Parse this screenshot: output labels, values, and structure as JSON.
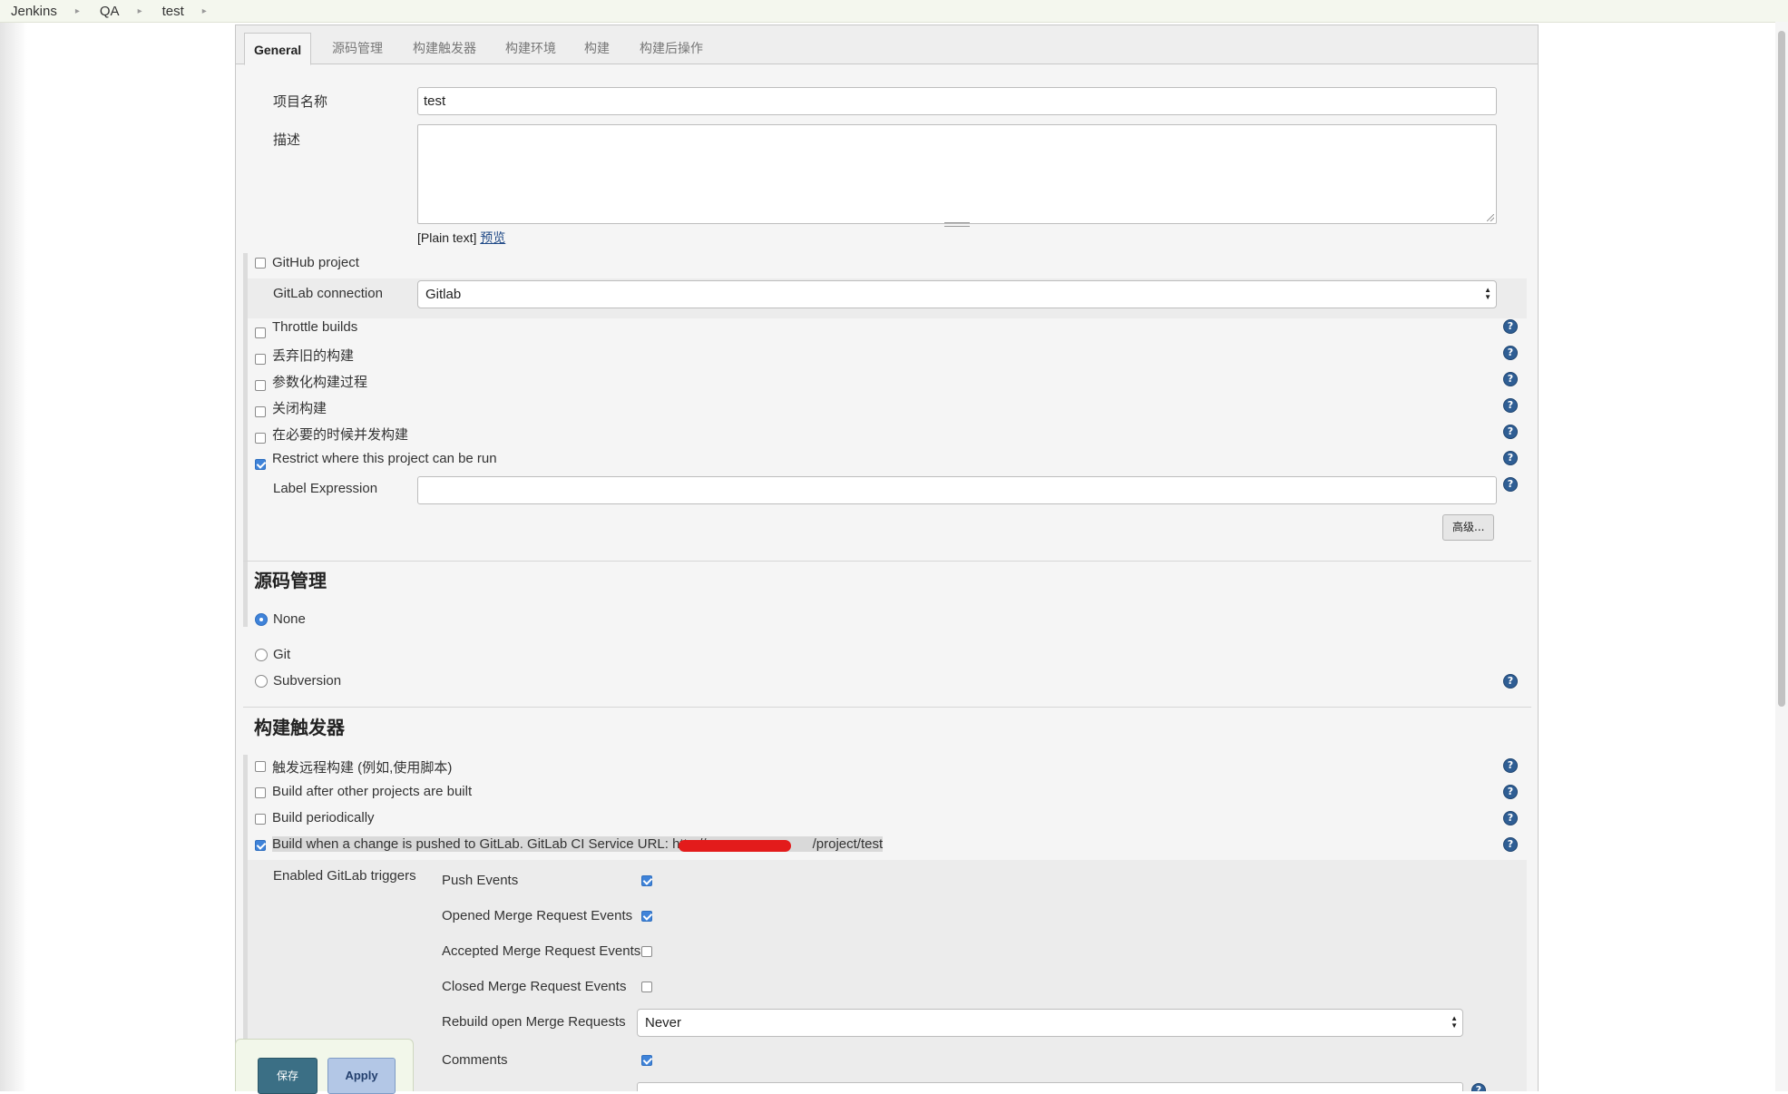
{
  "breadcrumb": {
    "items": [
      "Jenkins",
      "QA",
      "test"
    ]
  },
  "tabs": [
    "General",
    "源码管理",
    "构建触发器",
    "构建环境",
    "构建",
    "构建后操作"
  ],
  "general": {
    "project_name_label": "项目名称",
    "project_name_value": "test",
    "description_label": "描述",
    "description_value": "",
    "markup_note": "[Plain text]",
    "preview_link": "预览",
    "github_project": {
      "label": "GitHub project",
      "checked": false
    },
    "gitlab_connection_label": "GitLab connection",
    "gitlab_connection_value": "Gitlab",
    "options": [
      {
        "label": "Throttle builds",
        "checked": false
      },
      {
        "label": "丢弃旧的构建",
        "checked": false
      },
      {
        "label": "参数化构建过程",
        "checked": false
      },
      {
        "label": "关闭构建",
        "checked": false
      },
      {
        "label": "在必要的时候并发构建",
        "checked": false
      },
      {
        "label": "Restrict where this project can be run",
        "checked": true
      }
    ],
    "label_expression_label": "Label Expression",
    "label_expression_value": "",
    "advanced_button": "高级..."
  },
  "scm": {
    "title": "源码管理",
    "options": [
      {
        "label": "None",
        "selected": true
      },
      {
        "label": "Git",
        "selected": false
      },
      {
        "label": "Subversion",
        "selected": false
      }
    ]
  },
  "triggers": {
    "title": "构建触发器",
    "options": [
      {
        "label": "触发远程构建 (例如,使用脚本)",
        "checked": false
      },
      {
        "label": "Build after other projects are built",
        "checked": false
      },
      {
        "label": "Build periodically",
        "checked": false
      }
    ],
    "gitlab_trigger": {
      "label_prefix": "Build when a change is pushed to GitLab. GitLab CI Service URL: http://",
      "label_suffix": "/project/test",
      "checked": true
    },
    "enabled_triggers_label": "Enabled GitLab triggers",
    "events": [
      {
        "label": "Push Events",
        "checked": true
      },
      {
        "label": "Opened Merge Request Events",
        "checked": true
      },
      {
        "label": "Accepted Merge Request Events",
        "checked": false
      },
      {
        "label": "Closed Merge Request Events",
        "checked": false
      }
    ],
    "rebuild_label": "Rebuild open Merge Requests",
    "rebuild_value": "Never",
    "comments": {
      "label": "Comments",
      "checked": true
    }
  },
  "footer": {
    "save": "保存",
    "apply": "Apply"
  },
  "icons": {
    "help": "help-icon",
    "separator": "chevron-right-icon"
  },
  "colors": {
    "accent": "#3f83d9",
    "save_button": "#3b6f85",
    "apply_button": "#b3c7e6",
    "help_icon": "#2f5e94"
  }
}
